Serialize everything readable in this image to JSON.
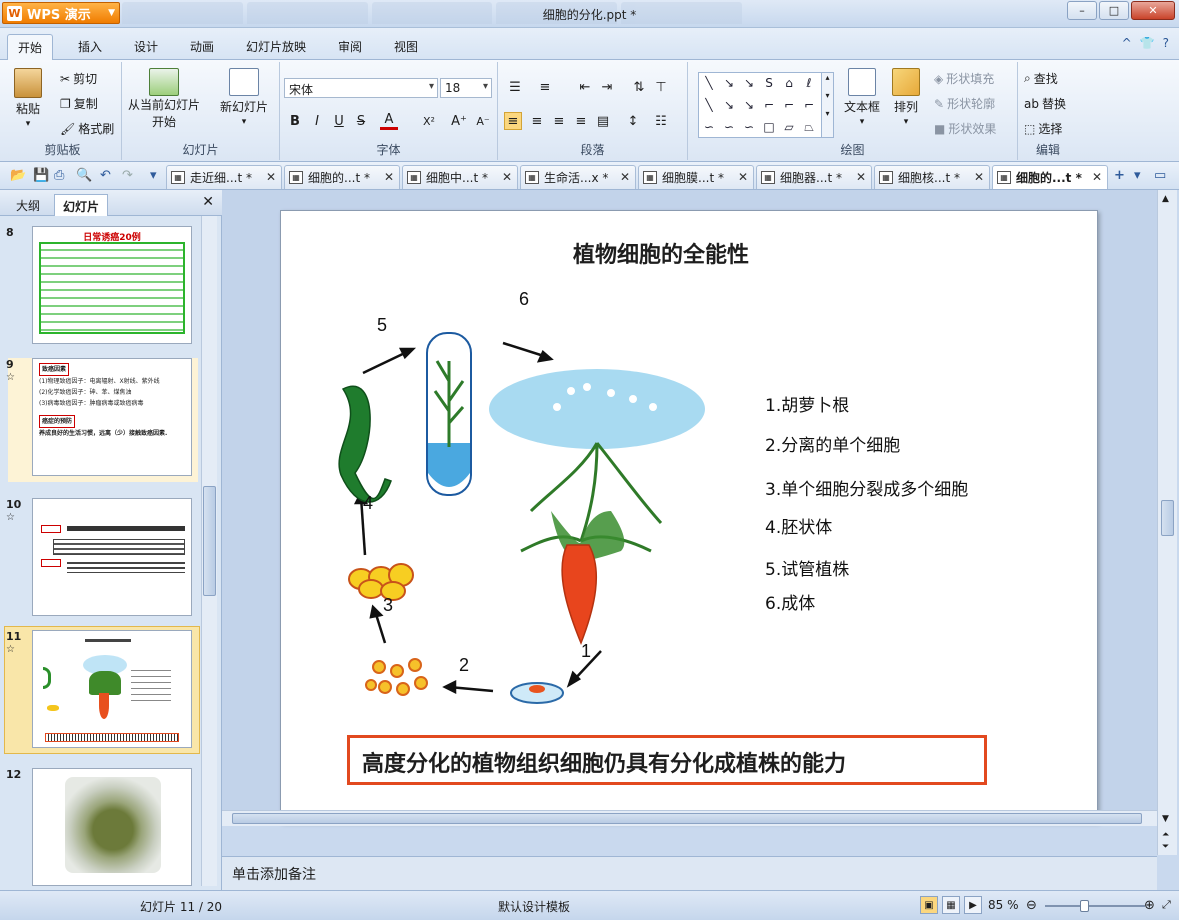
{
  "app": {
    "logo_text": "WPS 演示",
    "window_title": "细胞的分化.ppt *"
  },
  "window_controls": {
    "minimize": "–",
    "maximize": "□",
    "close": "✕"
  },
  "menu": {
    "items": [
      "开始",
      "插入",
      "设计",
      "动画",
      "幻灯片放映",
      "审阅",
      "视图"
    ],
    "active": "开始",
    "right_icons": [
      "^",
      "👕",
      "?"
    ]
  },
  "ribbon": {
    "clipboard": {
      "paste": "粘贴",
      "cut": "剪切",
      "copy": "复制",
      "format_painter": "格式刷",
      "label": "剪贴板"
    },
    "slides": {
      "from_current_1": "从当前幻灯片",
      "from_current_2": "开始",
      "new_slide": "新幻灯片",
      "label": "幻灯片"
    },
    "font": {
      "family": "宋体",
      "size": "18",
      "bold": "B",
      "italic": "I",
      "underline": "U",
      "strike": "S",
      "color": "A",
      "superscript": "X²",
      "grow": "A⁺",
      "shrink": "A⁻",
      "label": "字体"
    },
    "paragraph": {
      "label": "段落"
    },
    "drawing": {
      "textbox": "文本框",
      "arrange": "排列",
      "shape_fill": "形状填充",
      "shape_outline": "形状轮廓",
      "shape_effect": "形状效果",
      "label": "绘图"
    },
    "editing": {
      "find": "查找",
      "replace": "替换",
      "select": "选择",
      "label": "编辑"
    }
  },
  "doc_tabs": [
    {
      "label": "走近细...t *"
    },
    {
      "label": "细胞的...t *"
    },
    {
      "label": "细胞中...t *"
    },
    {
      "label": "生命活...x *"
    },
    {
      "label": "细胞膜...t *"
    },
    {
      "label": "细胞器...t *"
    },
    {
      "label": "细胞核...t *"
    },
    {
      "label": "细胞的...t *"
    }
  ],
  "panel": {
    "tab_outline": "大纲",
    "tab_slides": "幻灯片",
    "close": "✕"
  },
  "thumbnails": [
    {
      "num": "8",
      "title": "日常诱癌20例"
    },
    {
      "num": "9",
      "head": "致癌因素",
      "lines": [
        "(1)物理致癌因子：电离辐射、X射线、紫外线",
        "(2)化学致癌因子：砷、苯、煤焦油",
        "(3)病毒致癌因子：肿瘤病毒或致癌病毒"
      ],
      "sub": "癌症的预防",
      "foot": "养成良好的生活习惯，远离（少）接触致癌因素."
    },
    {
      "num": "10"
    },
    {
      "num": "11"
    },
    {
      "num": "12"
    }
  ],
  "slide": {
    "title": "植物细胞的全能性",
    "steps": [
      "1",
      "2",
      "3",
      "4",
      "5",
      "6"
    ],
    "legend": [
      "1.胡萝卜根",
      "2.分离的单个细胞",
      "3.单个细胞分裂成多个细胞",
      "4.胚状体",
      "5.试管植株",
      "6.成体"
    ],
    "conclusion": "高度分化的植物组织细胞仍具有分化成植株的能力"
  },
  "notes_placeholder": "单击添加备注",
  "status": {
    "slide_counter": "幻灯片 11 / 20",
    "template": "默认设计模板",
    "zoom": "85 %"
  },
  "colors": {
    "accent": "#e2491f",
    "wps_orange": "#f07c00",
    "ribbon_blue": "#dbe6f4"
  }
}
